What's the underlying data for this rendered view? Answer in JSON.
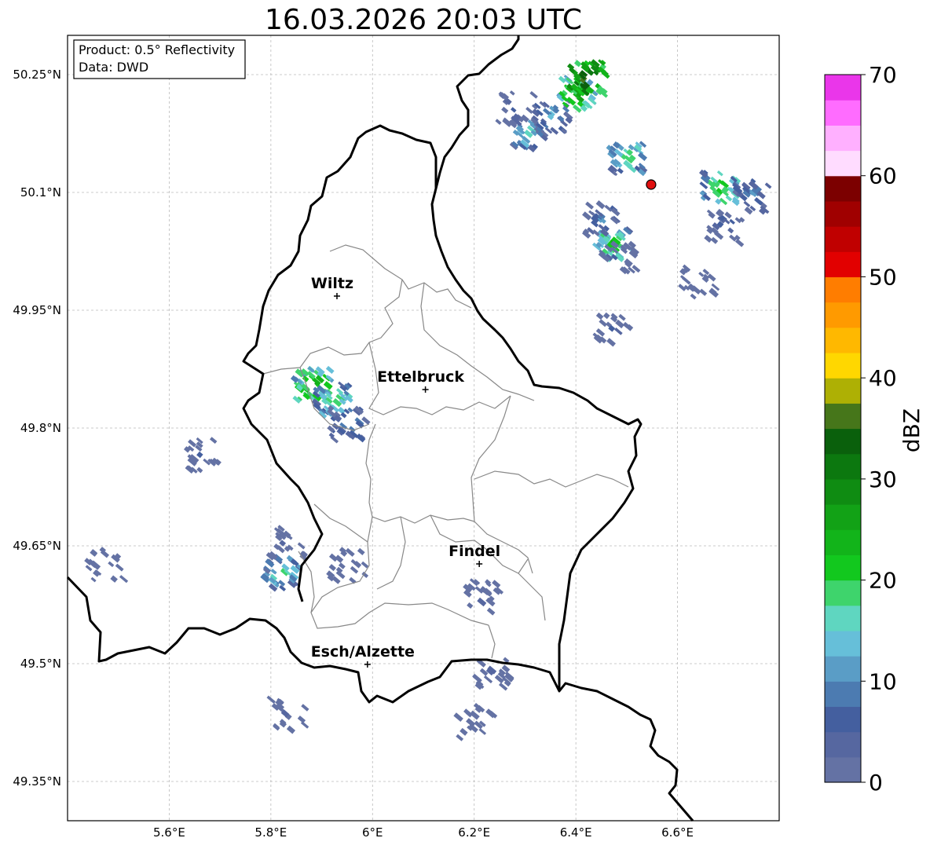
{
  "title": "16.03.2026 20:03 UTC",
  "infobox": {
    "product": "Product: 0.5° Reflectivity",
    "data": "Data: DWD"
  },
  "map": {
    "lon_range": [
      5.4,
      6.8
    ],
    "lat_range": [
      49.3,
      50.3
    ],
    "lon_ticks": [
      {
        "value": 5.6,
        "label": "5.6°E"
      },
      {
        "value": 5.8,
        "label": "5.8°E"
      },
      {
        "value": 6.0,
        "label": "6°E"
      },
      {
        "value": 6.2,
        "label": "6.2°E"
      },
      {
        "value": 6.4,
        "label": "6.4°E"
      },
      {
        "value": 6.6,
        "label": "6.6°E"
      }
    ],
    "lat_ticks": [
      {
        "value": 50.25,
        "label": "50.25°N"
      },
      {
        "value": 50.1,
        "label": "50.1°N"
      },
      {
        "value": 49.95,
        "label": "49.95°N"
      },
      {
        "value": 49.8,
        "label": "49.8°N"
      },
      {
        "value": 49.65,
        "label": "49.65°N"
      },
      {
        "value": 49.5,
        "label": "49.5°N"
      },
      {
        "value": 49.35,
        "label": "49.35°N"
      }
    ],
    "cities": [
      {
        "name": "Wiltz",
        "lon": 5.93,
        "lat": 49.968
      },
      {
        "name": "Ettelbruck",
        "lon": 6.104,
        "lat": 49.849
      },
      {
        "name": "Findel",
        "lon": 6.21,
        "lat": 49.627
      },
      {
        "name": "Esch/Alzette",
        "lon": 5.99,
        "lat": 49.499
      }
    ],
    "radar_site": {
      "lon": 6.548,
      "lat": 50.11,
      "color": "#e01010"
    },
    "echoes": [
      {
        "lon": 6.35,
        "lat": 50.2,
        "dbz": 15
      },
      {
        "lon": 6.4,
        "lat": 50.23,
        "dbz": 28
      },
      {
        "lon": 6.42,
        "lat": 50.25,
        "dbz": 38
      },
      {
        "lon": 6.3,
        "lat": 50.18,
        "dbz": 18
      },
      {
        "lon": 6.28,
        "lat": 50.21,
        "dbz": 8
      },
      {
        "lon": 6.5,
        "lat": 50.15,
        "dbz": 22
      },
      {
        "lon": 6.47,
        "lat": 50.04,
        "dbz": 24
      },
      {
        "lon": 6.45,
        "lat": 50.07,
        "dbz": 12
      },
      {
        "lon": 6.48,
        "lat": 50.02,
        "dbz": 8
      },
      {
        "lon": 6.68,
        "lat": 50.11,
        "dbz": 24
      },
      {
        "lon": 6.69,
        "lat": 50.06,
        "dbz": 10
      },
      {
        "lon": 6.74,
        "lat": 50.1,
        "dbz": 14
      },
      {
        "lon": 6.47,
        "lat": 49.93,
        "dbz": 6
      },
      {
        "lon": 6.64,
        "lat": 49.99,
        "dbz": 6
      },
      {
        "lon": 5.88,
        "lat": 49.86,
        "dbz": 28
      },
      {
        "lon": 5.92,
        "lat": 49.84,
        "dbz": 22
      },
      {
        "lon": 5.95,
        "lat": 49.81,
        "dbz": 14
      },
      {
        "lon": 5.66,
        "lat": 49.77,
        "dbz": 6
      },
      {
        "lon": 5.82,
        "lat": 49.62,
        "dbz": 20
      },
      {
        "lon": 5.83,
        "lat": 49.66,
        "dbz": 6
      },
      {
        "lon": 5.95,
        "lat": 49.63,
        "dbz": 6
      },
      {
        "lon": 6.21,
        "lat": 49.59,
        "dbz": 6
      },
      {
        "lon": 6.23,
        "lat": 49.49,
        "dbz": 6
      },
      {
        "lon": 5.47,
        "lat": 49.63,
        "dbz": 4
      },
      {
        "lon": 5.83,
        "lat": 49.44,
        "dbz": 4
      },
      {
        "lon": 6.2,
        "lat": 49.43,
        "dbz": 4
      }
    ]
  },
  "colorbar": {
    "label": "dBZ",
    "min": 0,
    "max": 70,
    "ticks": [
      0,
      10,
      20,
      30,
      40,
      50,
      60,
      70
    ],
    "colors": [
      "#6472a4",
      "#5667a0",
      "#445f9f",
      "#4c7bb1",
      "#5a9dc6",
      "#66bfd9",
      "#5fd6c0",
      "#3ed46c",
      "#12c81e",
      "#12b41a",
      "#12a216",
      "#0f8c12",
      "#0c780f",
      "#0a600c",
      "#46761a",
      "#aeb004",
      "#ffd700",
      "#ffb800",
      "#ff9a00",
      "#ff7d00",
      "#e20000",
      "#c00000",
      "#a00000",
      "#7c0000",
      "#ffdcff",
      "#ffb0ff",
      "#ff6cff",
      "#ea36ea"
    ]
  }
}
